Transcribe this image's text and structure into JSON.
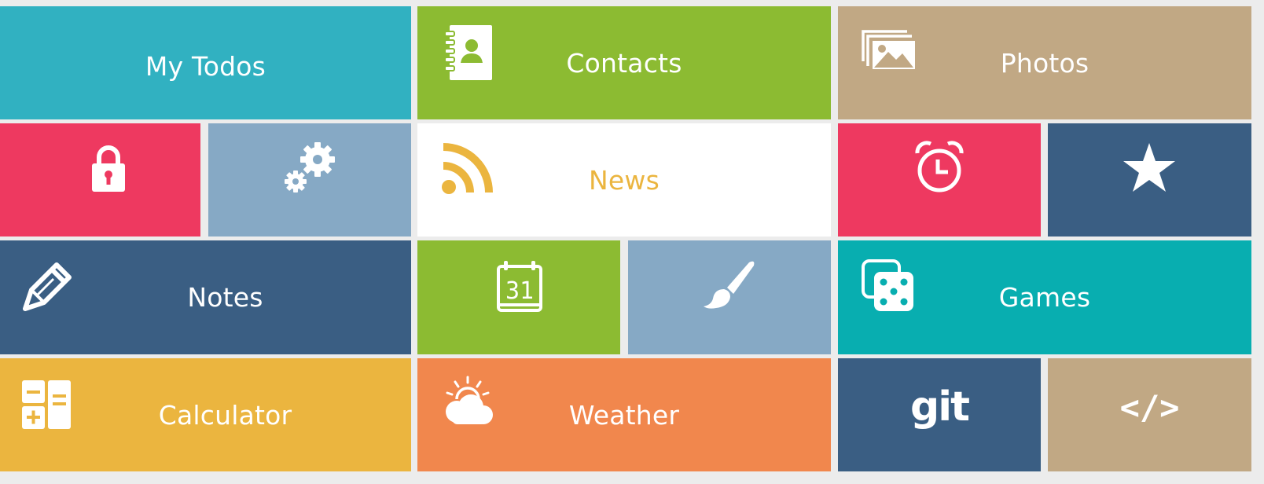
{
  "tiles": {
    "todos": {
      "label": "My Todos",
      "color": "#31b1c1"
    },
    "contacts": {
      "label": "Contacts",
      "color": "#8cbb32",
      "icon": "contact-book-icon"
    },
    "photos": {
      "label": "Photos",
      "color": "#c1a884",
      "icon": "photos-icon"
    },
    "lock": {
      "color": "#ee3960",
      "icon": "lock-icon"
    },
    "settings": {
      "color": "#86a9c5",
      "icon": "gears-icon"
    },
    "news": {
      "label": "News",
      "color": "#ffffff",
      "text_color": "#ebb53f",
      "icon": "rss-icon"
    },
    "alarm": {
      "color": "#ee3960",
      "icon": "alarm-clock-icon"
    },
    "favorites": {
      "color": "#3a5e83",
      "icon": "star-icon"
    },
    "notes": {
      "label": "Notes",
      "color": "#3a5e83",
      "icon": "pencil-icon"
    },
    "calendar": {
      "color": "#8cbb32",
      "icon": "calendar-icon",
      "day": "31"
    },
    "paint": {
      "color": "#86a9c5",
      "icon": "paint-brush-icon"
    },
    "games": {
      "label": "Games",
      "color": "#08aeb0",
      "icon": "dice-icon"
    },
    "calculator": {
      "label": "Calculator",
      "color": "#ebb53f",
      "icon": "calculator-icon"
    },
    "weather": {
      "label": "Weather",
      "color": "#f1874d",
      "icon": "weather-icon"
    },
    "git": {
      "text": "git",
      "color": "#3a5e83"
    },
    "code": {
      "text": "</>",
      "color": "#c1a884"
    }
  }
}
